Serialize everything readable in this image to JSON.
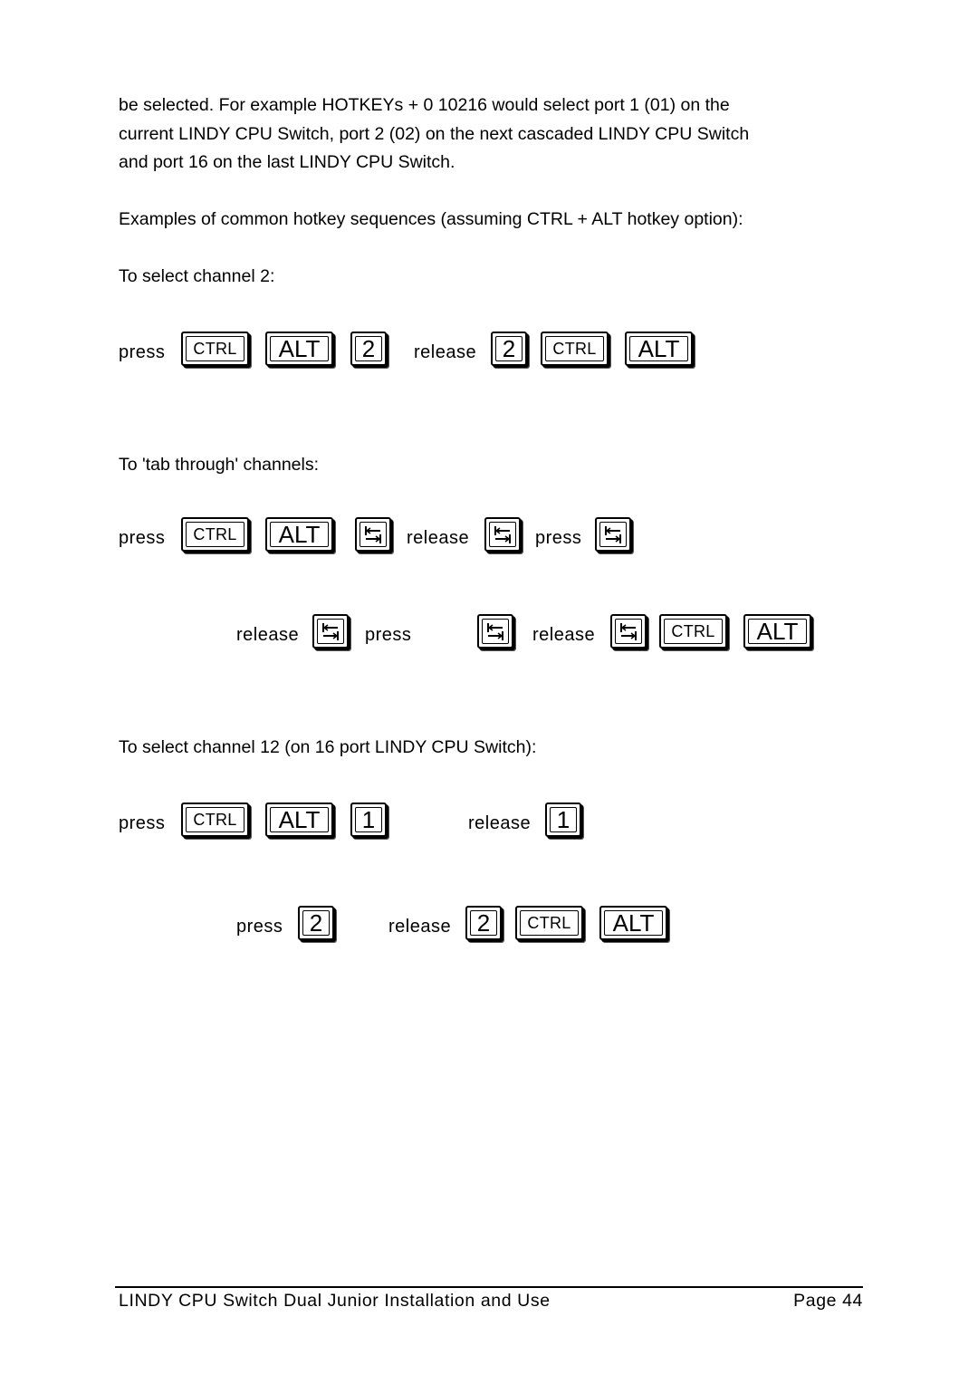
{
  "page": {
    "intro_lines": [
      "be selected. For example HOTKEYs + 0 10216 would select port 1 (01) on the",
      "current LINDY CPU Switch, port 2 (02) on the next cascaded LINDY CPU Switch",
      "and port 16 on the last LINDY CPU Switch."
    ],
    "examples_heading": "Examples of common hotkey sequences (assuming CTRL + ALT hotkey option):",
    "section1_title": "To select channel 2:",
    "section2_title": "To 'tab through' channels:",
    "section3_title": "To select channel 12 (on 16 port LINDY CPU Switch):"
  },
  "words": {
    "press": "press",
    "release": "release"
  },
  "keys": {
    "ctrl": "CTRL",
    "alt": "ALT",
    "two": "2",
    "one": "1",
    "tab_icon": "tab-icon"
  },
  "footer": {
    "title": "LINDY CPU Switch Dual Junior  Installation and Use",
    "page": "Page 44"
  }
}
